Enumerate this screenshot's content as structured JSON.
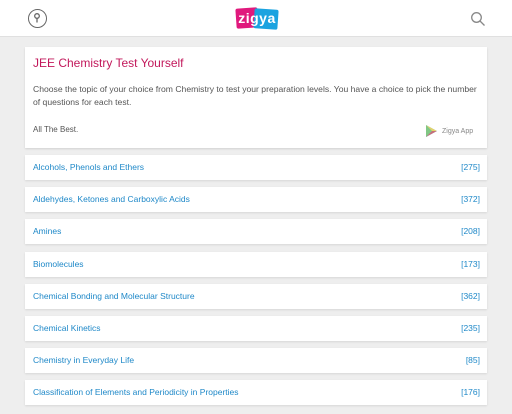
{
  "header": {
    "logo_text": "zigya",
    "menu_icon": "key-circle-icon",
    "search_icon": "search-icon",
    "colors": {
      "brand_pink": "#e0197d",
      "brand_blue": "#1ba3e0"
    }
  },
  "intro": {
    "title": "JEE Chemistry Test Yourself",
    "description": "Choose the topic of your choice from Chemistry to test your preparation levels. You have a choice to pick the number of questions for each test.",
    "closing": "All The Best.",
    "app_label": "Zigya App",
    "app_icon": "play-store-icon"
  },
  "topics": [
    {
      "label": "Alcohols, Phenols and Ethers",
      "count": "[275]"
    },
    {
      "label": "Aldehydes, Ketones and Carboxylic Acids",
      "count": "[372]"
    },
    {
      "label": "Amines",
      "count": "[208]"
    },
    {
      "label": "Biomolecules",
      "count": "[173]"
    },
    {
      "label": "Chemical Bonding and Molecular Structure",
      "count": "[362]"
    },
    {
      "label": "Chemical Kinetics",
      "count": "[235]"
    },
    {
      "label": "Chemistry in Everyday Life",
      "count": "[85]"
    },
    {
      "label": "Classification of Elements and Periodicity in Properties",
      "count": "[176]"
    }
  ]
}
